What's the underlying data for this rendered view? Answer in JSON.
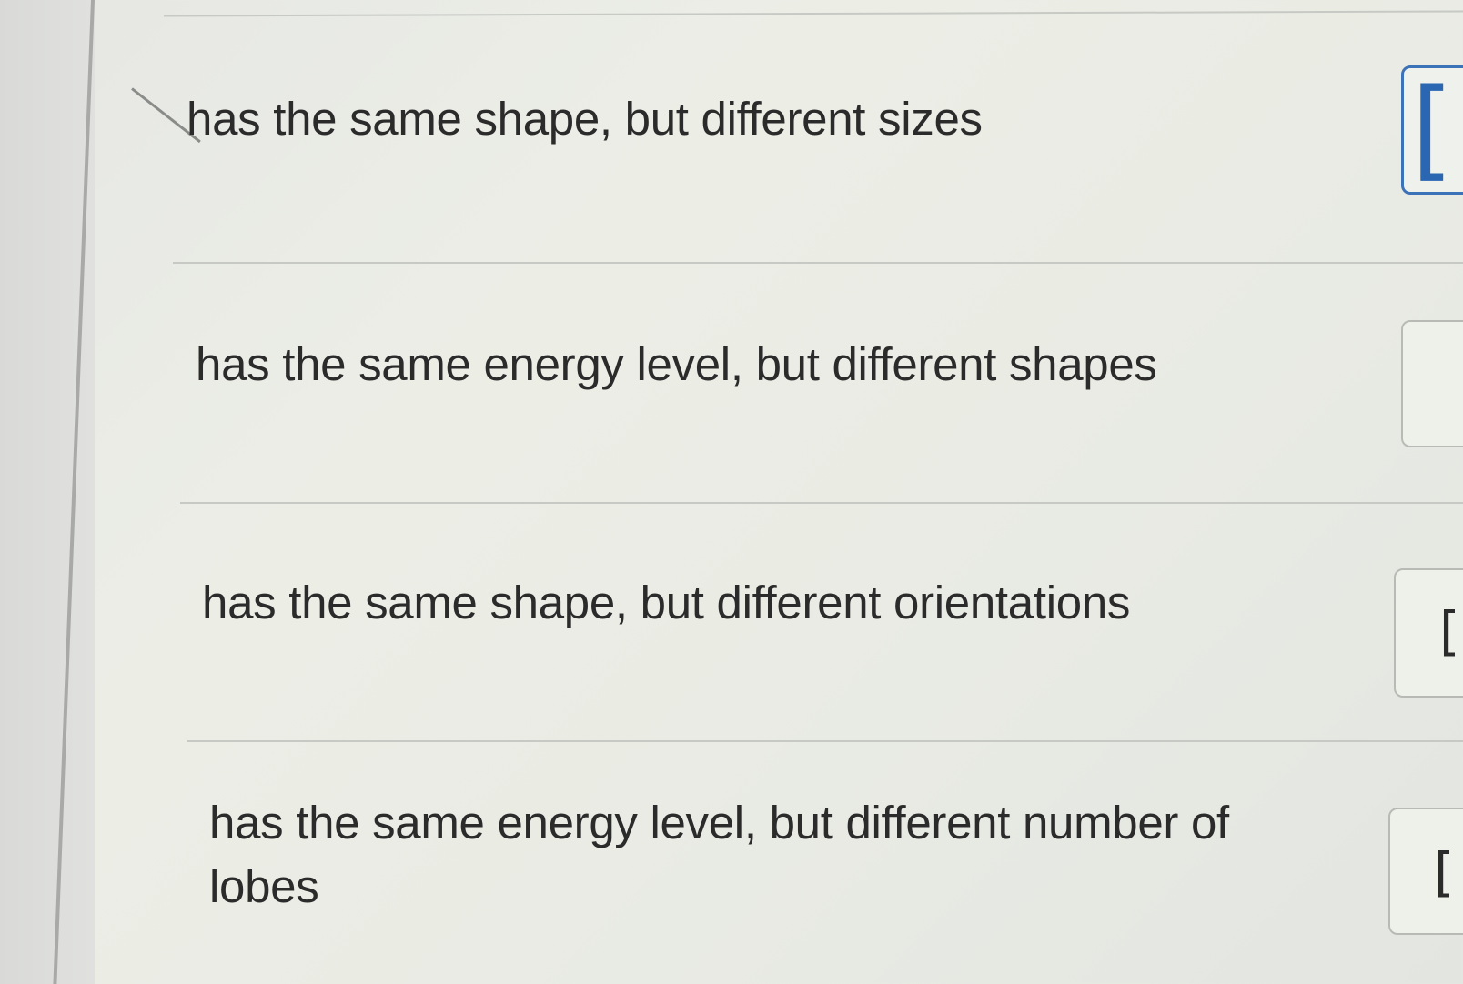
{
  "options": [
    {
      "text": "has the same shape, but different sizes"
    },
    {
      "text": "has the same energy level, but different shapes"
    },
    {
      "text": "has the same shape, but different orientations"
    },
    {
      "text": "has the same energy level, but different number of lobes"
    }
  ],
  "answer_boxes": [
    {
      "bracket": "["
    },
    {
      "bracket": ""
    },
    {
      "bracket": "["
    },
    {
      "bracket": "["
    }
  ],
  "colors": {
    "bracket_accent": "#1f5fae",
    "divider": "#c7c9c5",
    "text": "#2b2b2b"
  }
}
